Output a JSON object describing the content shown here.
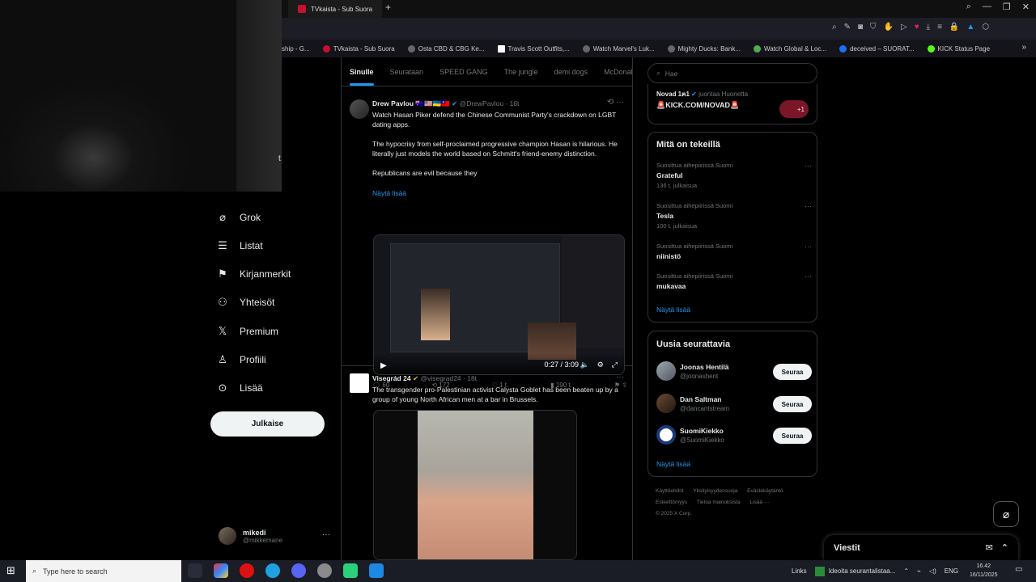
{
  "browser": {
    "tab_title": "TVkaista - Sub Suora",
    "bookmarks": [
      "ship - G...",
      "TVkaista - Sub Suora",
      "Osta CBD & CBG Ke...",
      "Travis Scott Outfits,...",
      "Watch Marvel's Luk...",
      "Mighty Ducks: Bank...",
      "Watch Global & Loc...",
      "deceived – SUORAT...",
      "KICK Status Page"
    ]
  },
  "webcam": {
    "partial_label": "t"
  },
  "nav": {
    "items": [
      {
        "label": "Grok",
        "icon": "grok-icon"
      },
      {
        "label": "Listat",
        "icon": "list-icon"
      },
      {
        "label": "Kirjanmerkit",
        "icon": "bookmark-icon"
      },
      {
        "label": "Yhteisöt",
        "icon": "communities-icon"
      },
      {
        "label": "Premium",
        "icon": "x-logo-icon"
      },
      {
        "label": "Profiili",
        "icon": "profile-icon"
      },
      {
        "label": "Lisää",
        "icon": "more-circle-icon"
      }
    ],
    "post_button": "Julkaise",
    "user": {
      "name": "mikedi",
      "handle": "@mikkemane"
    }
  },
  "feed": {
    "tabs": [
      "Sinulle",
      "Seurataan",
      "SPEED GANG",
      "The jungle",
      "demi dogs",
      "McDonal"
    ],
    "posts": [
      {
        "author": "Drew Pavlou 🇦🇺🇺🇸🇺🇦🇹🇼",
        "handle": "@DrewPavlou · 16t",
        "text": "Watch Hasan Piker defend the Chinese Communist Party's crackdown on LGBT dating apps.\n\nThe hypocrisy from self-proclaimed progressive champion Hasan is hilarious. He literally just models the world based on Schmitt's friend-enemy distinction.\n\nRepublicans are evil because they",
        "show_more": "Näytä lisää",
        "video_time": "0:27 / 3:09",
        "stats": {
          "replies": "60",
          "reposts": "172",
          "likes": "1 t.",
          "views": "190 t."
        }
      },
      {
        "author": "Visegrád 24",
        "handle": "@visegrad24 · 18t",
        "text": "The transgender pro-Palestinian activist Calysta Goblet has been beaten up by a group of young North African men at a bar in Brussels."
      }
    ]
  },
  "right": {
    "search_placeholder": "Hae",
    "live": {
      "name": "Novad 1ฅ1",
      "status": "juontaa Huonetta",
      "title": "🚨KICK.COM/NOVAD🚨",
      "badge": "+1"
    },
    "trends_title": "Mitä on tekeillä",
    "trends": [
      {
        "context": "Suosittua aihepiirissä Suomi",
        "name": "Grateful",
        "count": "136 t. julkaisua"
      },
      {
        "context": "Suosittua aihepiirissä Suomi",
        "name": "Tesla",
        "count": "100 t. julkaisua"
      },
      {
        "context": "Suosittua aihepiirissä Suomi",
        "name": "niinistö",
        "count": ""
      },
      {
        "context": "Suosittua aihepiirissä Suomi",
        "name": "mukavaa",
        "count": ""
      }
    ],
    "show_more": "Näytä lisää",
    "follow_title": "Uusia seurattavia",
    "follow": [
      {
        "name": "Joonas Hentilä",
        "handle": "@joonashent",
        "button": "Seuraa"
      },
      {
        "name": "Dan Saltman",
        "handle": "@dancantstream",
        "button": "Seuraa"
      },
      {
        "name": "SuomiKiekko",
        "handle": "@SuomiKiekko",
        "button": "Seuraa"
      }
    ],
    "footer": [
      "Käyttöehdot",
      "Yksityisyydensuoja",
      "Evästekäytäntö",
      "Esteettömyys",
      "Tietoa mainoksista",
      "Lisää ···",
      "© 2025 X Corp."
    ]
  },
  "messages": {
    "title": "Viestit"
  },
  "taskbar": {
    "search_placeholder": "Type here to search",
    "links": "Links",
    "notice": "Ideoita seurantalistaa...",
    "lang": "ENG",
    "time": "16.42",
    "date": "16/11/2025"
  }
}
